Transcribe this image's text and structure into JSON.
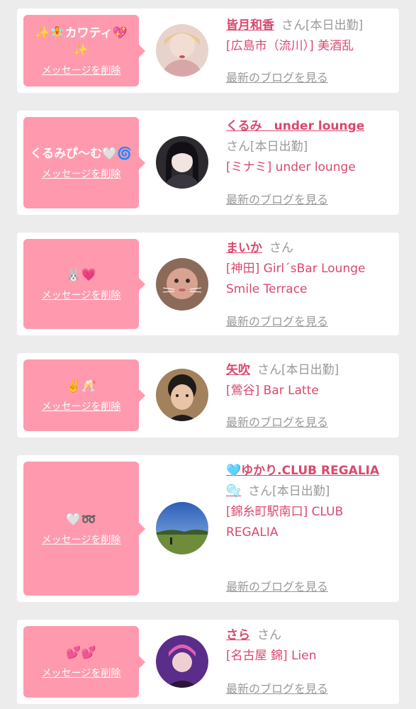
{
  "delete_label": "メッセージを削除",
  "blog_label": "最新のブログを見る",
  "honorific": "さん",
  "colors": {
    "accent": "#d9496e",
    "bubble": "#ff9aae",
    "muted": "#999999"
  },
  "cards": [
    {
      "message": "✨🧚カワティ💖✨",
      "name": "皆月和香",
      "status": "[本日出勤]",
      "place": "[広島市（流川）] 美酒乱"
    },
    {
      "message": "くるみぴ〜む🤍🌀",
      "name": "くるみ　under lounge",
      "status": "[本日出勤]",
      "place": "[ミナミ] under lounge"
    },
    {
      "message": "🐰💗",
      "name": "まいか",
      "status": "",
      "place": "[神田] Girl´sBar Lounge Smile Terrace"
    },
    {
      "message": "✌️🥂",
      "name": "矢吹",
      "status": "[本日出勤]",
      "place": "[鶯谷] Bar Latte"
    },
    {
      "message": "🤍➿",
      "name": "🩵ゆかり.CLUB REGALIA🫧",
      "status": "[本日出勤]",
      "place": "[錦糸町駅南口] CLUB REGALIA"
    },
    {
      "message": "💕💕",
      "name": "さら",
      "status": "",
      "place": "[名古屋 錦] Lien"
    }
  ]
}
